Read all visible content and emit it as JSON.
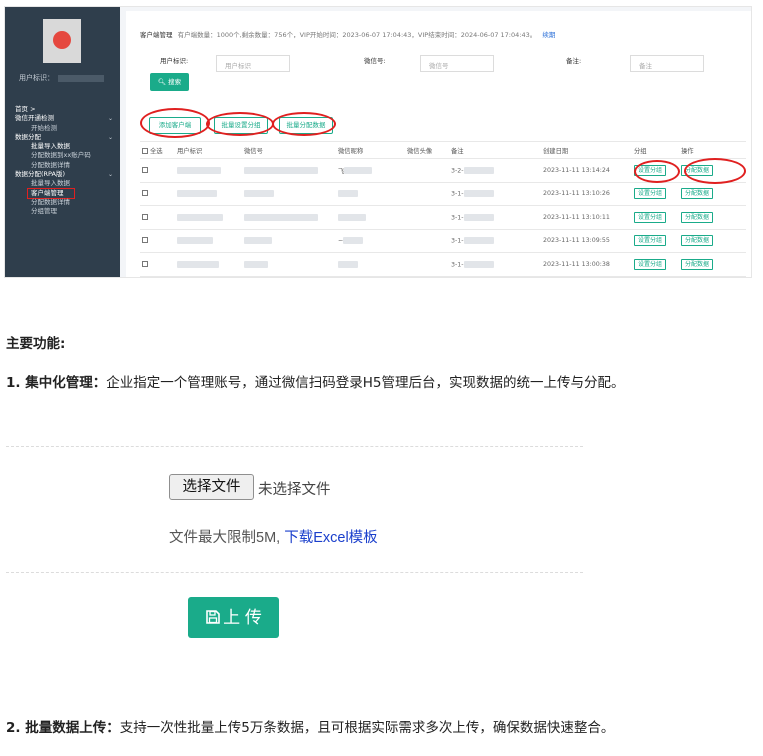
{
  "screenshot": {
    "sidebar": {
      "user_label": "用户标识：",
      "menu": [
        {
          "label": "首页 >",
          "type": "grp"
        },
        {
          "label": "微信开通检测",
          "type": "grp",
          "chevron": "⌄"
        },
        {
          "label": "开始检测",
          "type": "sub"
        },
        {
          "label": "数据分配",
          "type": "grp",
          "chevron": "⌄"
        },
        {
          "label": "批量导入数据",
          "type": "sub hl"
        },
        {
          "label": "分配数据到xx账户码",
          "type": "sub"
        },
        {
          "label": "分配数据详情",
          "type": "sub"
        },
        {
          "label": "数据分配(RPA版)",
          "type": "grp",
          "chevron": "⌄"
        },
        {
          "label": "批量导入数据",
          "type": "sub"
        },
        {
          "label": "客户端管理",
          "type": "sub hl"
        },
        {
          "label": "分配数据详情",
          "type": "sub"
        },
        {
          "label": "分组管理",
          "type": "sub"
        }
      ]
    },
    "topline": {
      "title": "客户端管理",
      "stats": "有户端数量：1000个,剩余数量：756个，VIP开始时间：2023-06-07 17:04:43，VIP结束时间：2024-06-07 17:04:43。",
      "link": "续期"
    },
    "filters": {
      "user_label": "用户标识:",
      "user_placeholder": "用户标识",
      "wechat_label": "微信号:",
      "wechat_placeholder": "微信号",
      "note_label": "备注:",
      "note_placeholder": "备注"
    },
    "search_button": "搜索",
    "actions": {
      "add": "添加客户端",
      "batch_group": "批量设置分组",
      "batch_assign": "批量分配数据"
    },
    "table": {
      "headers": [
        "全选",
        "用户标识",
        "微信号",
        "微信昵称",
        "微信头像",
        "备注",
        "创建日期",
        "分组",
        "操作"
      ],
      "rows": [
        {
          "nick": "飞",
          "note": "3-2-",
          "date": "2023-11-11 13:14:24"
        },
        {
          "nick": "",
          "note": "3-1-",
          "date": "2023-11-11 13:10:26"
        },
        {
          "nick": "",
          "note": "3-1-",
          "date": "2023-11-11 13:10:11"
        },
        {
          "nick": "~",
          "note": "3-1-",
          "date": "2023-11-11 13:09:55"
        },
        {
          "nick": "",
          "note": "3-1-",
          "date": "2023-11-11 13:00:38"
        }
      ],
      "group_btn": "设置分组",
      "assign_btn": "分配数据"
    }
  },
  "article": {
    "heading": "主要功能:",
    "p1_bold": "1. 集中化管理：",
    "p1_text": "企业指定一个管理账号，通过微信扫码登录H5管理后台，实现数据的统一上传与分配。",
    "choose_file": "选择文件",
    "no_file": "未选择文件",
    "limit_text": "文件最大限制5M, ",
    "template_link": "下载Excel模板",
    "upload_button": "上 传",
    "p2_bold": "2. 批量数据上传：",
    "p2_text": "支持一次性批量上传5万条数据，且可根据实际需求多次上传，确保数据快速整合。"
  },
  "colors": {
    "accent": "#1aab8a",
    "highlight": "#e02020",
    "sidebar": "#2f3e4c",
    "link": "#1a3fcc"
  },
  "icons": {
    "search": "search-icon",
    "save": "save-icon",
    "chevron": "chevron-down-icon"
  }
}
